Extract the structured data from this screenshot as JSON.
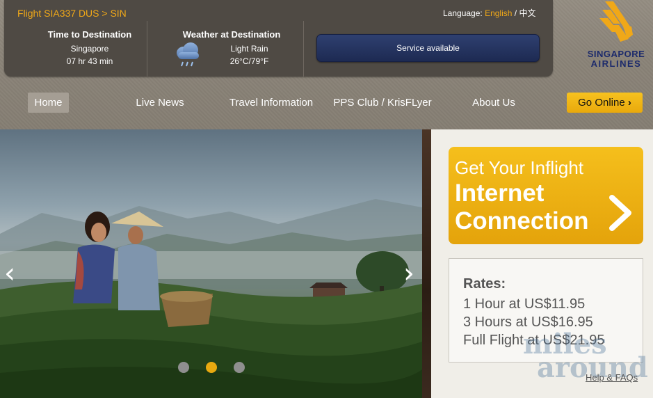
{
  "header": {
    "flight": "Flight SIA337 DUS > SIN",
    "language_label": "Language:",
    "language_english": "English",
    "language_sep": " / ",
    "language_chinese": "中文"
  },
  "time_to_destination": {
    "title": "Time to Destination",
    "city": "Singapore",
    "remaining": "07 hr 43 min"
  },
  "weather": {
    "title": "Weather at Destination",
    "condition": "Light Rain",
    "temperature": "26°C/79°F",
    "icon": "rain-cloud-icon"
  },
  "service_status": "Service available",
  "logo": {
    "line1": "SINGAPORE",
    "line2": "AIRLINES",
    "icon": "singapore-airlines-bird-icon",
    "color": "#f0a818"
  },
  "nav": {
    "items": [
      "Home",
      "Live News",
      "Travel Information",
      "PPS Club / KrisFLyer",
      "About Us"
    ],
    "active": "Home",
    "go_online": "Go Online"
  },
  "hero": {
    "prev_icon": "chevron-left-icon",
    "next_icon": "chevron-right-icon",
    "slides": 3,
    "active_slide": 2
  },
  "internet_promo": {
    "line1": "Get Your Inflight",
    "line2": "Internet",
    "line3": "Connection",
    "icon": "chevron-right-icon"
  },
  "rates": {
    "title": "Rates:",
    "items": [
      "1 Hour at US$11.95",
      "3 Hours at US$16.95",
      "Full Flight at US$21.95"
    ]
  },
  "help_link": "Help & FAQs",
  "watermark": {
    "line1": "miles",
    "line2": "around"
  },
  "colors": {
    "accent": "#f0a818",
    "navy": "#1c2a6b"
  }
}
